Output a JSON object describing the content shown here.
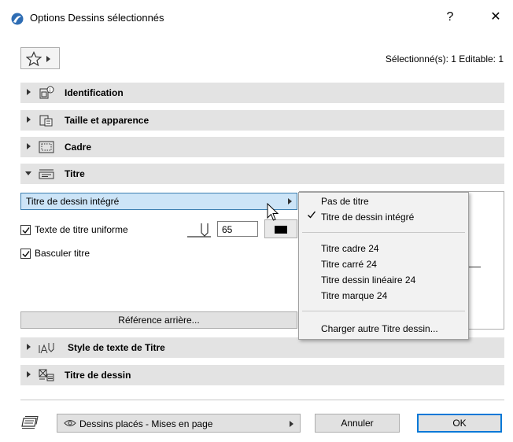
{
  "window": {
    "title": "Options Dessins sélectionnés",
    "help_label": "?",
    "close_label": "✕"
  },
  "header": {
    "selection_info": "Sélectionné(s): 1 Editable: 1"
  },
  "panels": [
    {
      "label": "Identification",
      "expanded": false
    },
    {
      "label": "Taille et apparence",
      "expanded": false
    },
    {
      "label": "Cadre",
      "expanded": false
    },
    {
      "label": "Titre",
      "expanded": true
    },
    {
      "label": "Style de texte de Titre",
      "expanded": false
    },
    {
      "label": "Titre de dessin",
      "expanded": false
    }
  ],
  "titre": {
    "type_value": "Titre de dessin intégré",
    "uniform_text_label": "Texte de titre uniforme",
    "uniform_text_checked": true,
    "pen_value": "65",
    "flip_title_label": "Basculer titre",
    "flip_title_checked": true,
    "back_reference_label": "Référence arrière..."
  },
  "menu": {
    "items_group1": [
      "Pas de titre",
      "Titre de dessin intégré"
    ],
    "checked_item": "Titre de dessin intégré",
    "items_group2": [
      "Titre cadre 24",
      "Titre carré 24",
      "Titre dessin linéaire 24",
      "Titre marque 24"
    ],
    "load_other_label": "Charger autre Titre dessin..."
  },
  "footer": {
    "view_label": "Dessins placés - Mises en page",
    "cancel_label": "Annuler",
    "ok_label": "OK"
  },
  "colors": {
    "panel_bg": "#e3e3e3",
    "dropdown_selected_bg": "#cce4f7",
    "accent": "#0078d7"
  }
}
